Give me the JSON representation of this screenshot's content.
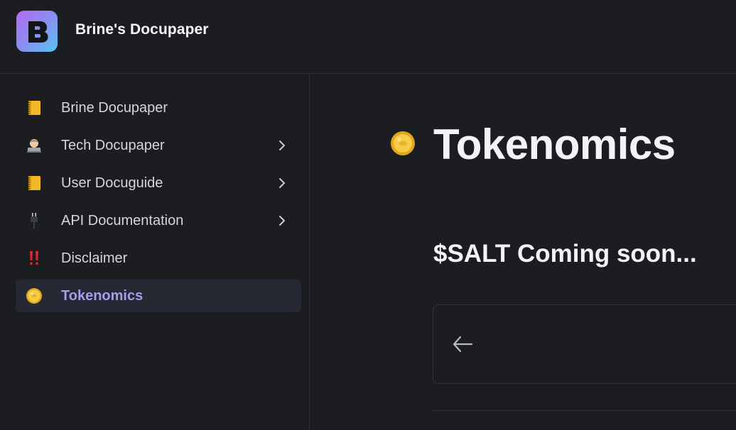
{
  "header": {
    "app_title": "Brine's Docupaper",
    "logo_icon": "brine-b-logo"
  },
  "sidebar": {
    "items": [
      {
        "label": "Brine Docupaper",
        "icon": "notebook-icon",
        "has_chevron": false,
        "active": false
      },
      {
        "label": "Tech Docupaper",
        "icon": "technologist-icon",
        "has_chevron": true,
        "active": false
      },
      {
        "label": "User Docuguide",
        "icon": "notebook-icon",
        "has_chevron": true,
        "active": false
      },
      {
        "label": "API Documentation",
        "icon": "plug-icon",
        "has_chevron": true,
        "active": false
      },
      {
        "label": "Disclaimer",
        "icon": "double-exclamation-icon",
        "has_chevron": false,
        "active": false
      },
      {
        "label": "Tokenomics",
        "icon": "coin-icon",
        "has_chevron": false,
        "active": true
      }
    ]
  },
  "main": {
    "title": "Tokenomics",
    "title_icon": "coin-icon",
    "subtitle": "$SALT Coming soon...",
    "prev_icon": "arrow-left-icon"
  },
  "colors": {
    "background": "#1b1d21",
    "border": "#2e3036",
    "active_bg": "#262833",
    "active_text": "#a99af0",
    "text": "#d4d6db"
  }
}
